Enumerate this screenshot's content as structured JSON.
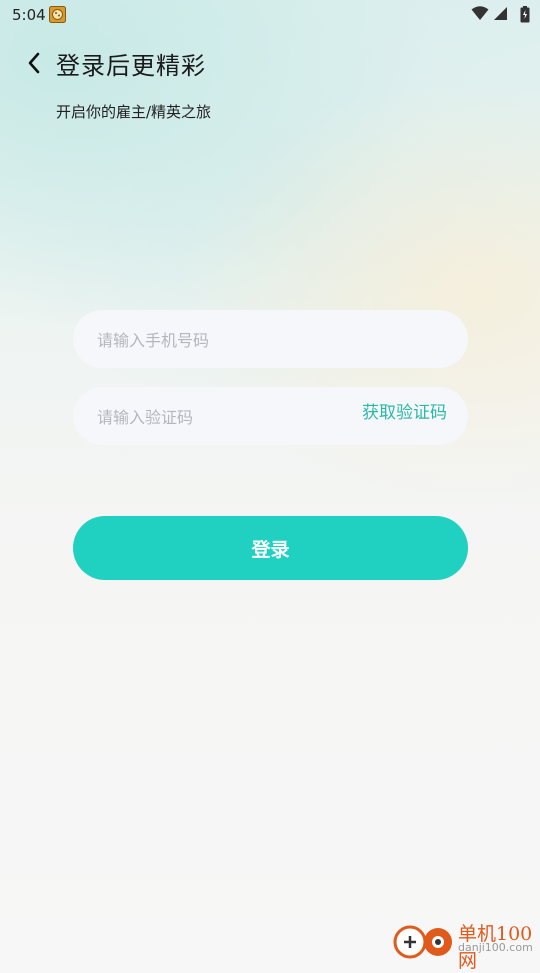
{
  "status_bar": {
    "time": "5:04",
    "icons": [
      "app-notification-icon",
      "wifi-icon",
      "cell-signal-icon",
      "battery-icon"
    ]
  },
  "header": {
    "back_icon": "chevron-left-icon",
    "title": "登录后更精彩",
    "subtitle": "开启你的雇主/精英之旅"
  },
  "form": {
    "phone_placeholder": "请输入手机号码",
    "phone_value": "",
    "code_placeholder": "请输入验证码",
    "code_value": "",
    "get_code_label": "获取验证码",
    "login_label": "登录"
  },
  "watermark": {
    "main": "单机100网",
    "sub": "danji100.com"
  },
  "colors": {
    "accent": "#20d1c2",
    "link": "#2cb8a8",
    "field_bg": "#f5f7fb",
    "placeholder": "#b3b6bc"
  }
}
